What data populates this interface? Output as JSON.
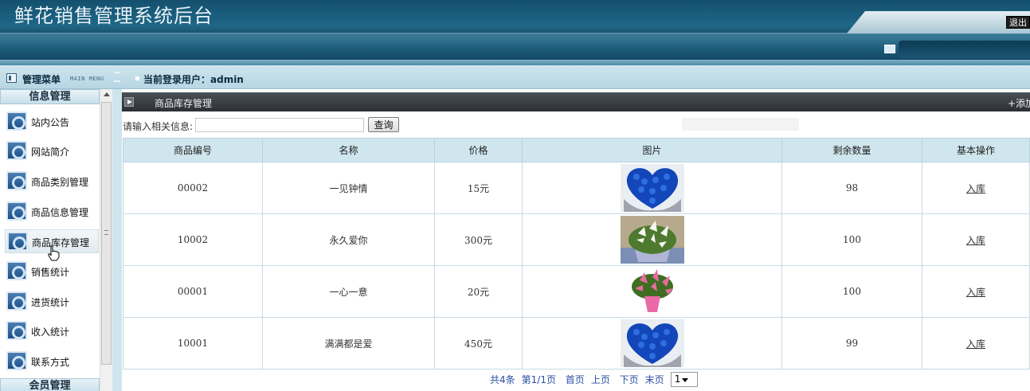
{
  "header": {
    "title": "鲜花销售管理系统后台",
    "logout_label": "退出"
  },
  "subbar": {
    "menu_title": "管理菜单",
    "menu_en": "MAIN MENU",
    "user_label": "当前登录用户：admin"
  },
  "sidebar": {
    "section1": "信息管理",
    "items": [
      {
        "label": "站内公告",
        "icon": "settings-icon"
      },
      {
        "label": "网站简介",
        "icon": "settings-icon"
      },
      {
        "label": "商品类别管理",
        "icon": "settings-icon"
      },
      {
        "label": "商品信息管理",
        "icon": "settings-icon"
      },
      {
        "label": "商品库存管理",
        "icon": "settings-icon",
        "active": true
      },
      {
        "label": "销售统计",
        "icon": "settings-icon"
      },
      {
        "label": "进货统计",
        "icon": "settings-icon"
      },
      {
        "label": "收入统计",
        "icon": "settings-icon"
      },
      {
        "label": "联系方式",
        "icon": "settings-icon"
      }
    ],
    "section2": "会员管理"
  },
  "main": {
    "panel_title": "商品库存管理",
    "add_label": "+添加",
    "search": {
      "label": "请输入相关信息:",
      "value": "",
      "button": "查询"
    },
    "table": {
      "headers": [
        "商品编号",
        "名称",
        "价格",
        "图片",
        "剩余数量",
        "基本操作"
      ],
      "rows": [
        {
          "code": "00002",
          "name": "一见钟情",
          "price": "15元",
          "image": "blue-rose-bouquet",
          "stock": "98",
          "action": "入库"
        },
        {
          "code": "10002",
          "name": "永久爱你",
          "price": "300元",
          "image": "white-lily-bouquet",
          "stock": "100",
          "action": "入库"
        },
        {
          "code": "00001",
          "name": "一心一意",
          "price": "20元",
          "image": "pink-lily-bouquet",
          "stock": "100",
          "action": "入库"
        },
        {
          "code": "10001",
          "name": "满满都是爱",
          "price": "450元",
          "image": "blue-rose-bouquet",
          "stock": "99",
          "action": "入库"
        }
      ]
    },
    "pager": {
      "total": "共4条",
      "page": "第1/1页",
      "first": "首页",
      "prev": "上页",
      "next": "下页",
      "last": "末页",
      "current": "1"
    }
  },
  "colors": {
    "header": "#1a4f6c",
    "table_header": "#cfe6ee",
    "panel_bar": "#2c3036",
    "link": "#2a4fa3"
  }
}
